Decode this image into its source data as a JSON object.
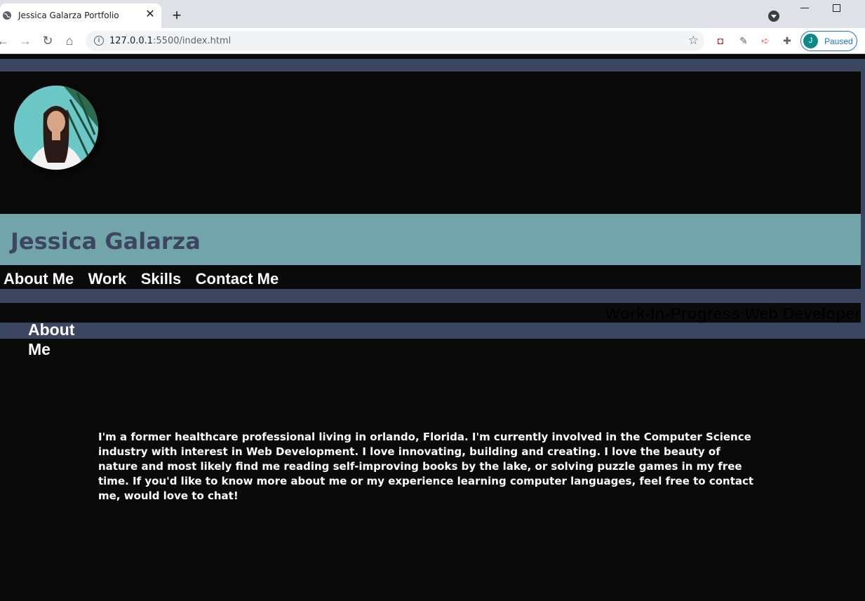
{
  "browser": {
    "tab_title": "Jessica Galarza Portfolio",
    "url_host": "127.0.0.1",
    "url_path": ":5500/index.html",
    "profile_initial": "J",
    "profile_status": "Paused"
  },
  "site": {
    "name": "Jessica Galarza",
    "nav": [
      "About Me",
      "Work",
      "Skills",
      "Contact Me"
    ],
    "tagline": "Work-In-Progress Web Developer",
    "about_heading": "About Me",
    "about_text": "I'm a former healthcare professional living in orlando, Florida. I'm currently involved in the Computer Science industry with interest in Web Development. I love innovating, building and creating. I love the beauty of nature and most likely find me reading self-improving books by the lake, or solving puzzle games in my free time. If you'd like to know more about me or my experience learning computer languages, feel free to contact me, would love to chat!"
  },
  "colors": {
    "frame": "#3d4660",
    "name_bar": "#72a5a9",
    "background": "#0a0a0b"
  }
}
